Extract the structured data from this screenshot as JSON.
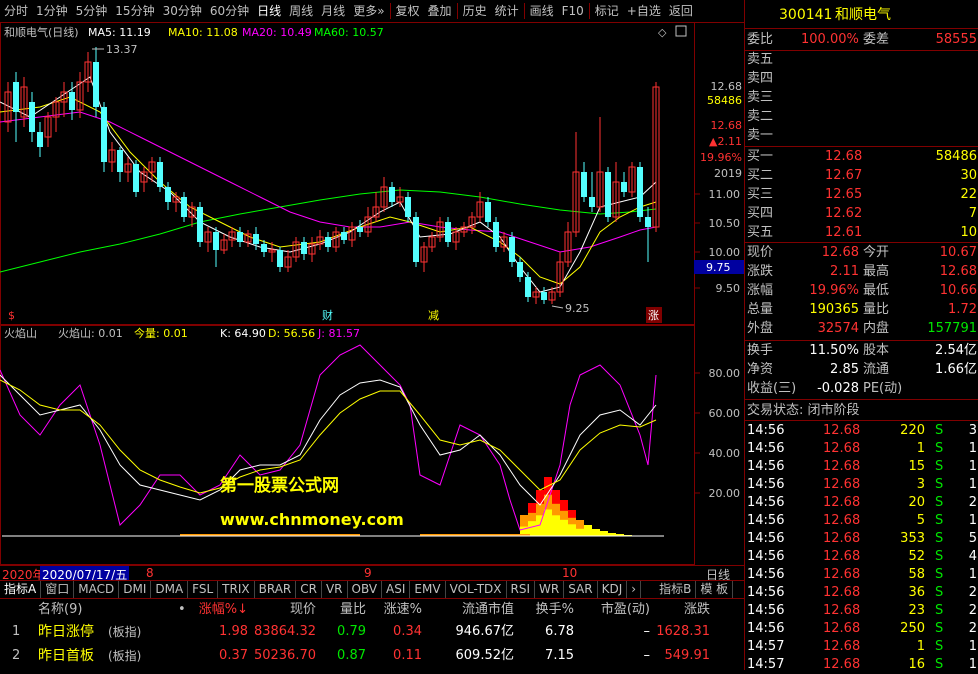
{
  "toolbar": {
    "items": [
      "分时",
      "1分钟",
      "5分钟",
      "15分钟",
      "30分钟",
      "60分钟",
      "日线",
      "周线",
      "月线",
      "更多»",
      "复权",
      "叠加",
      "历史",
      "统计",
      "画线",
      "F10",
      "标记",
      "+自选",
      "返回"
    ],
    "active_index": 6
  },
  "main_chart": {
    "title": "和顺电气(日线)",
    "ma5": "MA5: 11.19",
    "ma10": "MA10: 11.08",
    "ma20": "MA20: 10.49",
    "ma60": "MA60: 10.57",
    "high_label": "13.37",
    "low_label": "9.25",
    "axis_ticks": [
      "11.00",
      "10.50",
      "10.00",
      "9.50"
    ],
    "right_labels": {
      "price": "12.68",
      "volume": "58486",
      "price2": "12.68",
      "chg": "▲2.11",
      "pct": "19.96%",
      "year": "2019"
    },
    "cursor_price": "9.75",
    "markers": [
      "$",
      "财",
      "减",
      "涨"
    ],
    "colors": {
      "up": "#ff3232",
      "down": "#54ffff",
      "ma5": "#ffffff",
      "ma10": "#ffff00",
      "ma20": "#ff00ff",
      "ma60": "#00ff00"
    }
  },
  "sub_chart": {
    "name": "火焰山",
    "value1": "火焰山: 0.01",
    "value2": "今量: 0.01",
    "k": "K: 64.90",
    "d": "D: 56.56",
    "j": "J: 81.57",
    "axis_ticks": [
      "80.00",
      "60.00",
      "40.00",
      "20.00"
    ],
    "watermark1": "第一股票公式网",
    "watermark2": "www.chnmoney.com"
  },
  "date_axis": {
    "year": "2020年",
    "cursor_date": "2020/07/17/五",
    "months": [
      "8",
      "9",
      "10"
    ],
    "period": "日线"
  },
  "tabs": [
    "指标A",
    "窗口",
    "MACD",
    "DMI",
    "DMA",
    "FSL",
    "TRIX",
    "BRAR",
    "CR",
    "VR",
    "OBV",
    "ASI",
    "EMV",
    "VOL-TDX",
    "RSI",
    "WR",
    "SAR",
    "KDJ",
    "›",
    "指标B",
    "模 板"
  ],
  "table": {
    "headers": [
      "名称(9)",
      "•",
      "涨幅%↓",
      "现价",
      "量比",
      "涨速%",
      "流通市值",
      "换手%",
      "市盈(动)",
      "涨跌"
    ],
    "rows": [
      {
        "idx": "1",
        "name": "昨日涨停",
        "tag": "(板指)",
        "pct": "1.98",
        "price": "83864.32",
        "vr": "0.79",
        "speed": "0.34",
        "mcap": "946.67亿",
        "turn": "6.78",
        "pe": "–",
        "chg": "1628.31"
      },
      {
        "idx": "2",
        "name": "昨日首板",
        "tag": "(板指)",
        "pct": "0.37",
        "price": "50236.70",
        "vr": "0.87",
        "speed": "0.11",
        "mcap": "609.52亿",
        "turn": "7.15",
        "pe": "–",
        "chg": "549.91"
      }
    ]
  },
  "quote": {
    "code": "300141",
    "name": "和顺电气",
    "weibi_label": "委比",
    "weibi": "100.00%",
    "weicha_label": "委差",
    "weicha": "58555",
    "sells": [
      "卖五",
      "卖四",
      "卖三",
      "卖二",
      "卖一"
    ],
    "buys": [
      {
        "label": "买一",
        "price": "12.68",
        "vol": "58486"
      },
      {
        "label": "买二",
        "price": "12.67",
        "vol": "30"
      },
      {
        "label": "买三",
        "price": "12.65",
        "vol": "22"
      },
      {
        "label": "买四",
        "price": "12.62",
        "vol": "7"
      },
      {
        "label": "买五",
        "price": "12.61",
        "vol": "10"
      }
    ],
    "stats": [
      {
        "l1": "现价",
        "v1": "12.68",
        "l2": "今开",
        "v2": "10.67"
      },
      {
        "l1": "涨跌",
        "v1": "2.11",
        "l2": "最高",
        "v2": "12.68"
      },
      {
        "l1": "涨幅",
        "v1": "19.96%",
        "l2": "最低",
        "v2": "10.66"
      },
      {
        "l1": "总量",
        "v1": "190365",
        "l2": "量比",
        "v2": "1.72"
      },
      {
        "l1": "外盘",
        "v1": "32574",
        "l2": "内盘",
        "v2": "157791"
      }
    ],
    "stats2": [
      {
        "l1": "换手",
        "v1": "11.50%",
        "l2": "股本",
        "v2": "2.54亿"
      },
      {
        "l1": "净资",
        "v1": "2.85",
        "l2": "流通",
        "v2": "1.66亿"
      },
      {
        "l1": "收益(三)",
        "v1": "-0.028",
        "l2": "PE(动)",
        "v2": ""
      }
    ],
    "status": "交易状态: 闭市阶段",
    "ticks": [
      {
        "t": "14:56",
        "p": "12.68",
        "v": "220",
        "s": "S",
        "n": "3"
      },
      {
        "t": "14:56",
        "p": "12.68",
        "v": "1",
        "s": "S",
        "n": "1"
      },
      {
        "t": "14:56",
        "p": "12.68",
        "v": "15",
        "s": "S",
        "n": "1"
      },
      {
        "t": "14:56",
        "p": "12.68",
        "v": "3",
        "s": "S",
        "n": "1"
      },
      {
        "t": "14:56",
        "p": "12.68",
        "v": "20",
        "s": "S",
        "n": "2"
      },
      {
        "t": "14:56",
        "p": "12.68",
        "v": "5",
        "s": "S",
        "n": "1"
      },
      {
        "t": "14:56",
        "p": "12.68",
        "v": "353",
        "s": "S",
        "n": "5"
      },
      {
        "t": "14:56",
        "p": "12.68",
        "v": "52",
        "s": "S",
        "n": "4"
      },
      {
        "t": "14:56",
        "p": "12.68",
        "v": "58",
        "s": "S",
        "n": "1"
      },
      {
        "t": "14:56",
        "p": "12.68",
        "v": "36",
        "s": "S",
        "n": "2"
      },
      {
        "t": "14:56",
        "p": "12.68",
        "v": "23",
        "s": "S",
        "n": "2"
      },
      {
        "t": "14:56",
        "p": "12.68",
        "v": "250",
        "s": "S",
        "n": "2"
      },
      {
        "t": "14:57",
        "p": "12.68",
        "v": "1",
        "s": "S",
        "n": "1"
      },
      {
        "t": "14:57",
        "p": "12.68",
        "v": "16",
        "s": "S",
        "n": "1"
      }
    ]
  }
}
